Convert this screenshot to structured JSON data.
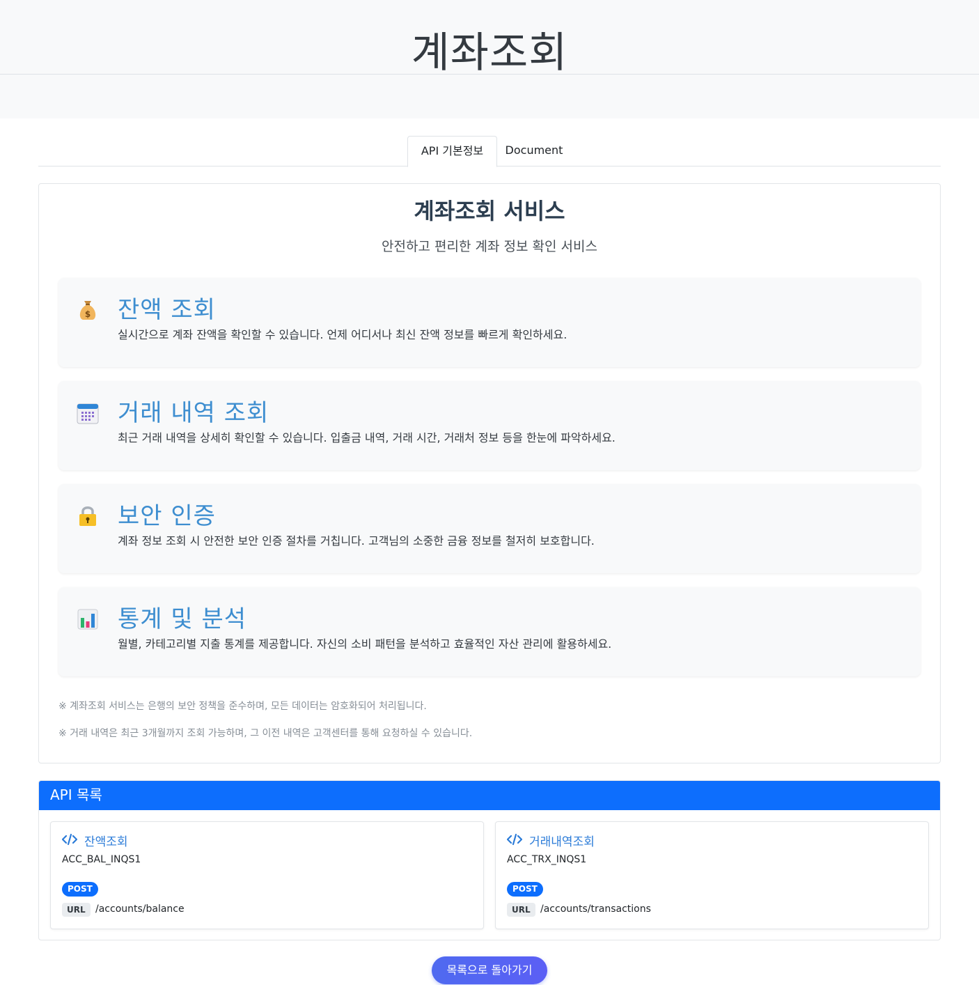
{
  "hero": {
    "title": "계좌조회"
  },
  "tabs": [
    {
      "label": "API 기본정보",
      "active": true
    },
    {
      "label": "Document",
      "active": false
    }
  ],
  "service": {
    "title": "계좌조회 서비스",
    "subtitle": "안전하고 편리한 계좌 정보 확인 서비스",
    "features": [
      {
        "icon": "money-bag-icon",
        "title": "잔액 조회",
        "desc": "실시간으로 계좌 잔액을 확인할 수 있습니다. 언제 어디서나 최신 잔액 정보를 빠르게 확인하세요."
      },
      {
        "icon": "calendar-icon",
        "title": "거래 내역 조회",
        "desc": "최근 거래 내역을 상세히 확인할 수 있습니다. 입출금 내역, 거래 시간, 거래처 정보 등을 한눈에 파악하세요."
      },
      {
        "icon": "lock-icon",
        "title": "보안 인증",
        "desc": "계좌 정보 조회 시 안전한 보안 인증 절차를 거칩니다. 고객님의 소중한 금융 정보를 철저히 보호합니다."
      },
      {
        "icon": "bar-chart-icon",
        "title": "통계 및 분석",
        "desc": "월별, 카테고리별 지출 통계를 제공합니다. 자신의 소비 패턴을 분석하고 효율적인 자산 관리에 활용하세요."
      }
    ],
    "notes": [
      "※ 계좌조회 서비스는 은행의 보안 정책을 준수하며, 모든 데이터는 암호화되어 처리됩니다.",
      "※ 거래 내역은 최근 3개월까지 조회 가능하며, 그 이전 내역은 고객센터를 통해 요청하실 수 있습니다."
    ]
  },
  "api_list": {
    "header": "API 목록",
    "items": [
      {
        "name": "잔액조회",
        "id": "ACC_BAL_INQS1",
        "method": "POST",
        "url_label": "URL",
        "url": "/accounts/balance"
      },
      {
        "name": "거래내역조회",
        "id": "ACC_TRX_INQS1",
        "method": "POST",
        "url_label": "URL",
        "url": "/accounts/transactions"
      }
    ]
  },
  "back_button": {
    "label": "목록으로 돌아가기"
  },
  "colors": {
    "primary": "#0d6efd",
    "feature_title": "#3e8ed0",
    "api_name": "#2b7bd8"
  }
}
